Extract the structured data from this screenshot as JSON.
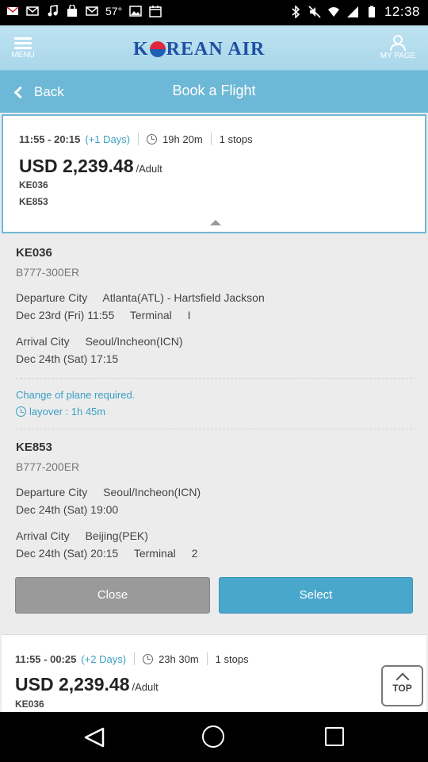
{
  "status_bar": {
    "time": "12:38",
    "left_icons": [
      "gmail-icon",
      "mail-icon",
      "music-icon",
      "shopping-bag-icon",
      "mail-icon",
      "temperature-icon",
      "image-icon",
      "calendar-icon"
    ],
    "temperature": "57°"
  },
  "header": {
    "menu_label": "MENU",
    "logo_text_left": "K",
    "logo_text_right": "REAN AIR",
    "mypage_label": "MY PAGE"
  },
  "nav": {
    "back_label": "Back",
    "title": "Book a Flight"
  },
  "flight_option_1": {
    "times": "11:55 - 20:15",
    "days": "(+1 Days)",
    "duration": "19h 20m",
    "stops": "1 stops",
    "price": "USD 2,239.48",
    "per": "/Adult",
    "flights": [
      "KE036",
      "KE853"
    ]
  },
  "segments": [
    {
      "flight_no": "KE036",
      "aircraft": "B777-300ER",
      "departure_label": "Departure City",
      "departure_city": "Atlanta(ATL) - Hartsfield Jackson",
      "departure_datetime": "Dec 23rd (Fri) 11:55",
      "departure_terminal_label": "Terminal",
      "departure_terminal": "I",
      "arrival_label": "Arrival City",
      "arrival_city": "Seoul/Incheon(ICN)",
      "arrival_datetime": "Dec 24th (Sat) 17:15"
    },
    {
      "flight_no": "KE853",
      "aircraft": "B777-200ER",
      "departure_label": "Departure City",
      "departure_city": "Seoul/Incheon(ICN)",
      "departure_datetime": "Dec 24th (Sat) 19:00",
      "arrival_label": "Arrival City",
      "arrival_city": "Beijing(PEK)",
      "arrival_datetime": "Dec 24th (Sat) 20:15",
      "arrival_terminal_label": "Terminal",
      "arrival_terminal": "2"
    }
  ],
  "connection": {
    "change_text": "Change of plane required.",
    "layover_text": "layover : 1h 45m"
  },
  "buttons": {
    "close": "Close",
    "select": "Select",
    "top": "TOP"
  },
  "flight_option_2": {
    "times": "11:55 - 00:25",
    "days": "(+2 Days)",
    "duration": "23h 30m",
    "stops": "1 stops",
    "price": "USD 2,239.48",
    "per": "/Adult",
    "flights": [
      "KE036"
    ]
  },
  "colors": {
    "accent": "#6db8d6",
    "select_button": "#4aa7cc",
    "close_button": "#9a9a9a",
    "link_text": "#3a9fc4"
  }
}
